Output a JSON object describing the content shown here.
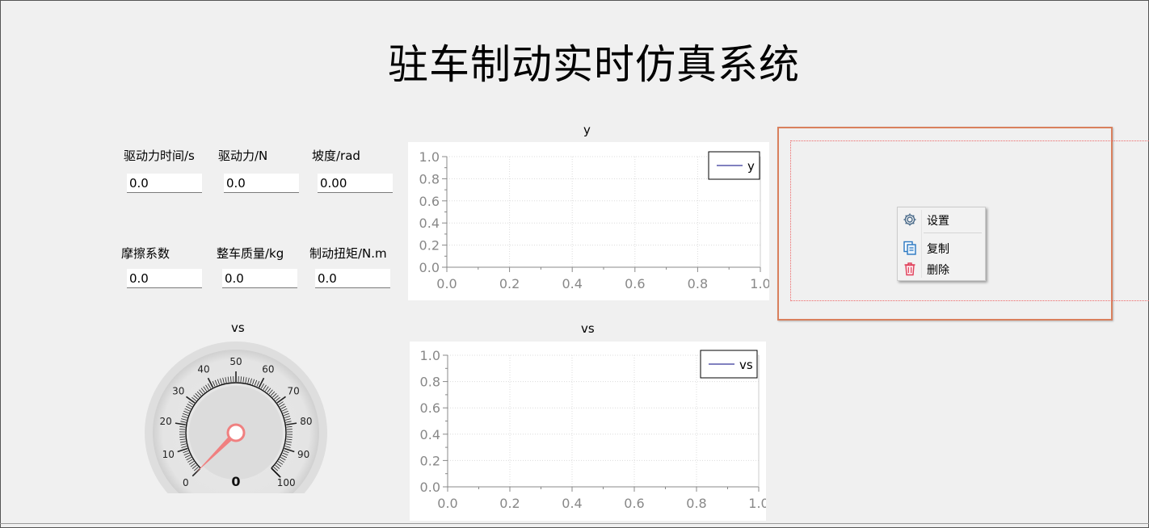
{
  "window": {
    "title": "驻车制动实时仿真系统"
  },
  "inputs": [
    {
      "label": "驱动力时间/s",
      "value": "0.0"
    },
    {
      "label": "驱动力/N",
      "value": "0.0"
    },
    {
      "label": "坡度/rad",
      "value": "0.00"
    },
    {
      "label": "摩擦系数",
      "value": "0.0"
    },
    {
      "label": "整车质量/kg",
      "value": "0.0"
    },
    {
      "label": "制动扭矩/N.m",
      "value": "0.0"
    }
  ],
  "gauge": {
    "title": "vs",
    "value": 0,
    "value_text": "0",
    "min": 0,
    "max": 100,
    "tick_labels": [
      "0",
      "10",
      "20",
      "30",
      "40",
      "50",
      "60",
      "70",
      "80",
      "90",
      "100"
    ],
    "needle_color": "#f08080"
  },
  "chart_data": [
    {
      "type": "line",
      "title": "y",
      "xlim": [
        0.0,
        1.0
      ],
      "ylim": [
        0.0,
        1.0
      ],
      "x_ticks": [
        "0.0",
        "0.2",
        "0.4",
        "0.6",
        "0.8",
        "1.0"
      ],
      "y_ticks": [
        "0.0",
        "0.2",
        "0.4",
        "0.6",
        "0.8",
        "1.0"
      ],
      "grid": true,
      "legend": "top-right",
      "series": [
        {
          "name": "y",
          "color": "#00007f",
          "x": [],
          "y": []
        }
      ]
    },
    {
      "type": "line",
      "title": "vs",
      "xlim": [
        0.0,
        1.0
      ],
      "ylim": [
        0.0,
        1.0
      ],
      "x_ticks": [
        "0.0",
        "0.2",
        "0.4",
        "0.6",
        "0.8",
        "1.0"
      ],
      "y_ticks": [
        "0.0",
        "0.2",
        "0.4",
        "0.6",
        "0.8",
        "1.0"
      ],
      "grid": true,
      "legend": "top-right",
      "series": [
        {
          "name": "vs",
          "color": "#00007f",
          "x": [],
          "y": []
        }
      ]
    }
  ],
  "context_menu": {
    "items": [
      {
        "label": "设置",
        "icon": "gear-icon"
      },
      {
        "label": "复制",
        "icon": "copy-icon"
      },
      {
        "label": "删除",
        "icon": "trash-icon"
      }
    ]
  },
  "colors": {
    "background": "#f0f0f0",
    "selection_border": "#d9805d",
    "dotted_guide": "#ee6666"
  }
}
